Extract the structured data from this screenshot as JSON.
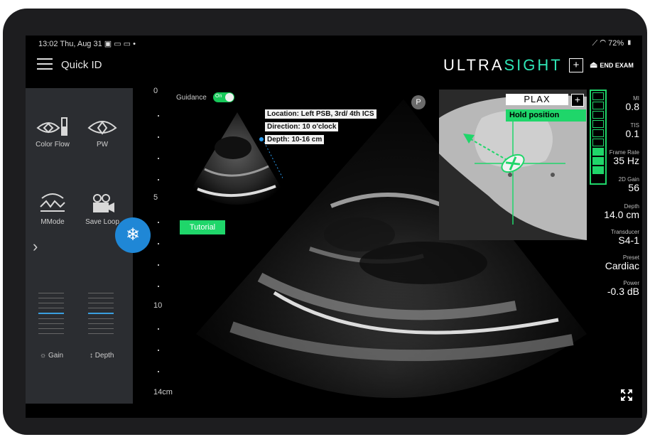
{
  "status_bar": {
    "time": "13:02",
    "date": "Thu, Aug 31",
    "battery": "72%"
  },
  "header": {
    "mode_title": "Quick ID",
    "logo_plain": "ULTRA",
    "logo_accent": "SIGHT",
    "add_label": "+",
    "end_exam_label": "END EXAM"
  },
  "sidebar": {
    "tools": [
      {
        "label": "Color Flow",
        "icon": "color-flow-icon"
      },
      {
        "label": "PW",
        "icon": "pw-icon"
      },
      {
        "label": "MMode",
        "icon": "mmode-icon"
      },
      {
        "label": "Save Loop",
        "icon": "camera-icon"
      }
    ],
    "expand_glyph": "›",
    "gain_label": "Gain",
    "depth_label": "Depth"
  },
  "freeze": {
    "glyph": "❄"
  },
  "ruler": {
    "marks": [
      "0",
      "5",
      "10"
    ],
    "bottom": "14cm"
  },
  "guidance": {
    "label": "Guidance",
    "toggle_text": "On"
  },
  "tutorial_label": "Tutorial",
  "instructions": {
    "location": "Location: Left PSB, 3rd/ 4th ICS",
    "direction": "Direction: 10 o'clock",
    "depth": "Depth: 10-16 cm"
  },
  "probe_badge": "P",
  "view": {
    "name": "PLAX",
    "add": "+",
    "hint": "Hold position"
  },
  "quality_meter": {
    "level": 0.3,
    "segments": 9
  },
  "params": [
    {
      "label": "MI",
      "value": "0.8"
    },
    {
      "label": "TIS",
      "value": "0.1"
    },
    {
      "label": "Frame Rate",
      "value": "35 Hz"
    },
    {
      "label": "2D Gain",
      "value": "56"
    },
    {
      "label": "Depth",
      "value": "14.0 cm"
    },
    {
      "label": "Transducer",
      "value": "S4-1"
    },
    {
      "label": "Preset",
      "value": "Cardiac"
    },
    {
      "label": "Power",
      "value": "-0.3 dB"
    }
  ],
  "colors": {
    "accent": "#1fd66a",
    "freeze": "#1f87d6",
    "panel": "#2b2d31"
  }
}
